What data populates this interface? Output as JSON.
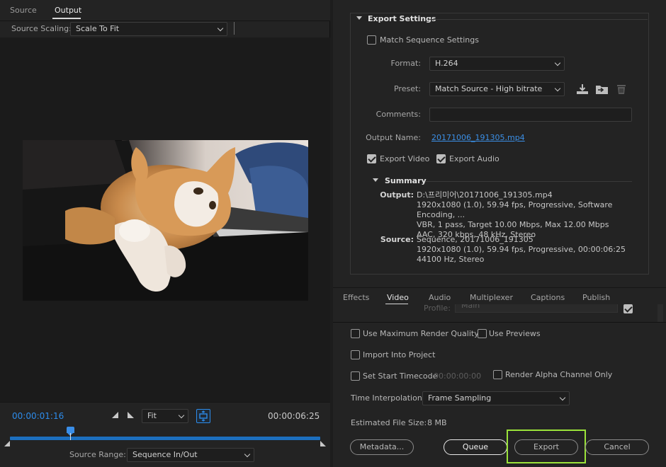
{
  "left": {
    "tabs": [
      {
        "label": "Source",
        "active": false
      },
      {
        "label": "Output",
        "active": true
      }
    ],
    "source_scaling_label": "Source Scaling:",
    "source_scaling_value": "Scale To Fit",
    "current_time": "00:00:01:16",
    "zoom_value": "Fit",
    "duration": "00:00:06:25",
    "source_range_label": "Source Range:",
    "source_range_value": "Sequence In/Out"
  },
  "export_settings": {
    "header": "Export Settings",
    "match_sequence_label": "Match Sequence Settings",
    "match_sequence_checked": false,
    "format_label": "Format:",
    "format_value": "H.264",
    "preset_label": "Preset:",
    "preset_value": "Match Source - High bitrate",
    "comments_label": "Comments:",
    "comments_value": "",
    "output_name_label": "Output Name:",
    "output_name_value": "20171006_191305.mp4",
    "export_video_label": "Export Video",
    "export_video_checked": true,
    "export_audio_label": "Export Audio",
    "export_audio_checked": true
  },
  "summary": {
    "header": "Summary",
    "output_label": "Output:",
    "output_lines": [
      "D:\\프리미어\\20171006_191305.mp4",
      "1920x1080 (1.0), 59.94 fps, Progressive, Software Encoding, ...",
      "VBR, 1 pass, Target 10.00 Mbps, Max 12.00 Mbps",
      "AAC, 320 kbps, 48 kHz, Stereo"
    ],
    "source_label": "Source:",
    "source_lines": [
      "Sequence, 20171006_191305",
      "1920x1080 (1.0), 59.94 fps, Progressive, 00:00:06:25",
      "44100 Hz, Stereo"
    ]
  },
  "settings_tabs": [
    {
      "label": "Effects",
      "active": false
    },
    {
      "label": "Video",
      "active": true
    },
    {
      "label": "Audio",
      "active": false
    },
    {
      "label": "Multiplexer",
      "active": false
    },
    {
      "label": "Captions",
      "active": false
    },
    {
      "label": "Publish",
      "active": false
    }
  ],
  "partial_row": {
    "label": "Profile:",
    "value": "Main"
  },
  "options": {
    "max_render_quality": "Use Maximum Render Quality",
    "use_previews": "Use Previews",
    "import_into_project": "Import Into Project",
    "set_start_timecode": "Set Start Timecode",
    "start_timecode_value": "00:00:00:00",
    "render_alpha": "Render Alpha Channel Only",
    "time_interpolation_label": "Time Interpolation:",
    "time_interpolation_value": "Frame Sampling",
    "estimated_size_label": "Estimated File Size:",
    "estimated_size_value": "8 MB"
  },
  "buttons": {
    "metadata": "Metadata...",
    "queue": "Queue",
    "export": "Export",
    "cancel": "Cancel"
  },
  "colors": {
    "accent_blue": "#2d8ceb",
    "highlight_green": "#9be33a",
    "panel_bg": "#232323"
  }
}
